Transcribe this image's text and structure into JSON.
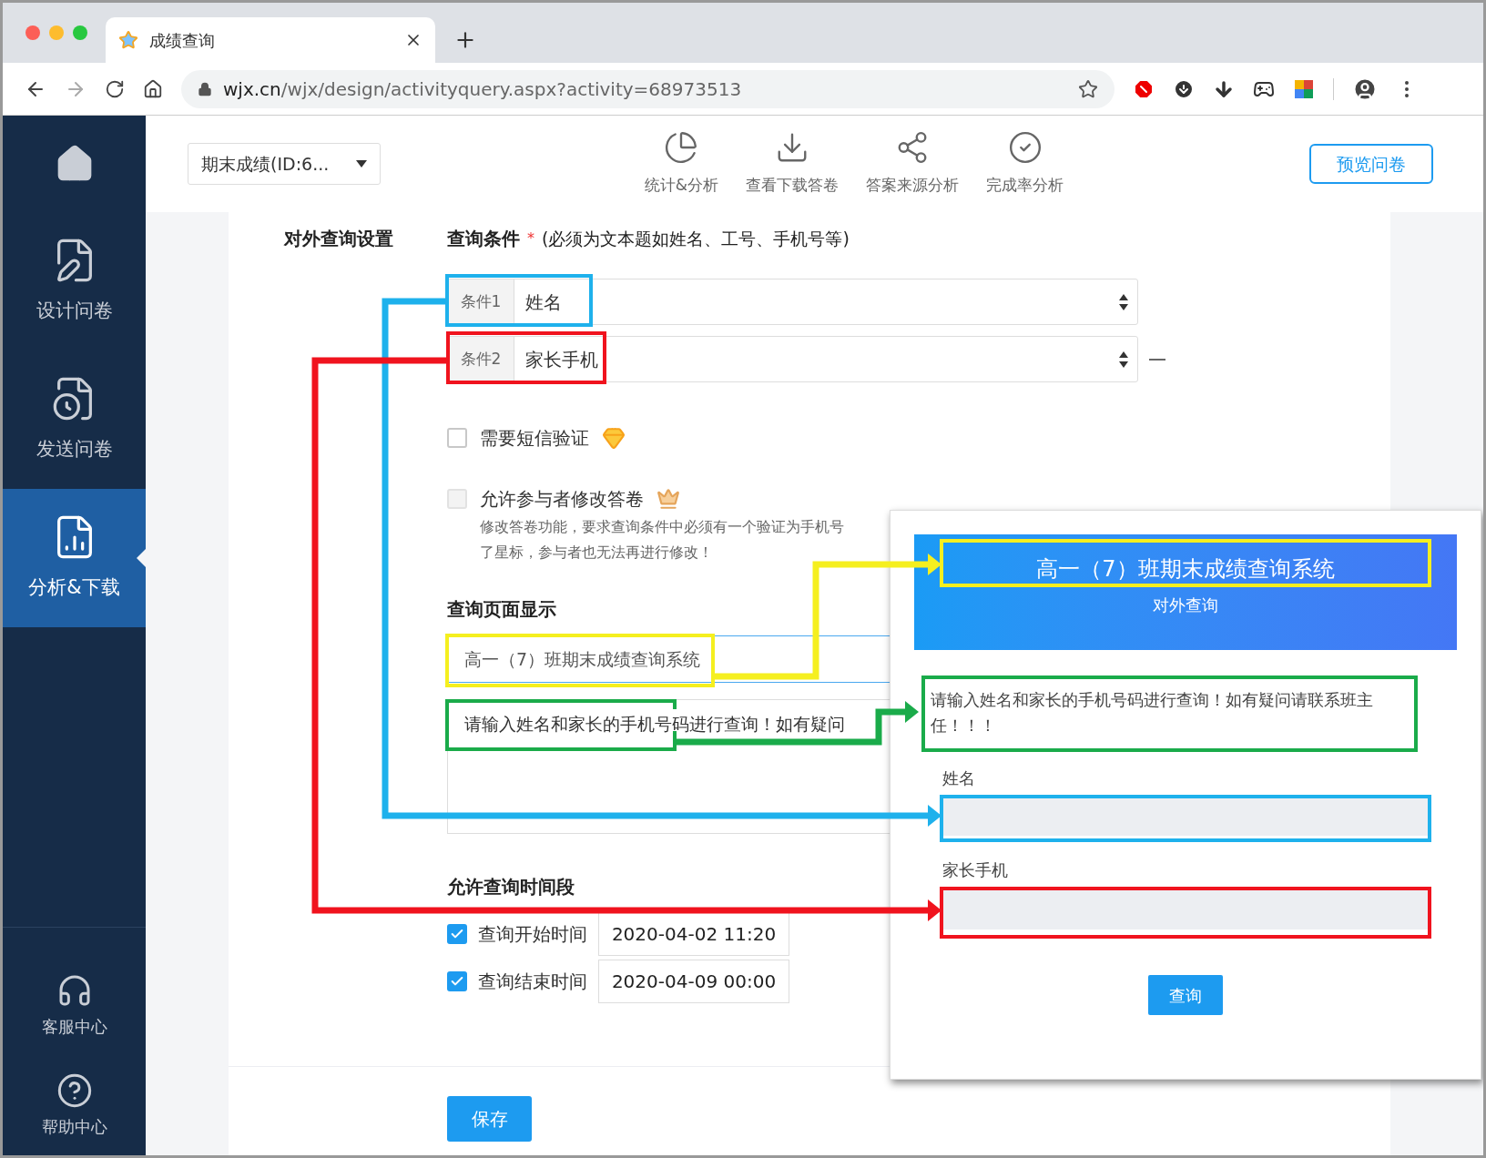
{
  "browser": {
    "tab_title": "成绩查询",
    "url_host": "wjx.cn",
    "url_path": "/wjx/design/activityquery.aspx?activity=68973513"
  },
  "sidebar": {
    "items": [
      {
        "label": "设计问卷",
        "selected": false
      },
      {
        "label": "发送问卷",
        "selected": false
      },
      {
        "label": "分析&下载",
        "selected": true
      }
    ],
    "footer_items": [
      {
        "label": "客服中心"
      },
      {
        "label": "帮助中心"
      }
    ]
  },
  "toolbar": {
    "survey_select": "期末成绩(ID:6...",
    "nav": [
      {
        "label": "统计&分析"
      },
      {
        "label": "查看下载答卷"
      },
      {
        "label": "答案来源分析"
      },
      {
        "label": "完成率分析"
      }
    ],
    "preview_button": "预览问卷"
  },
  "settings": {
    "section_label": "对外查询设置",
    "conditions_heading": "查询条件",
    "required_mark": "*",
    "conditions_hint": "(必须为文本题如姓名、工号、手机号等)",
    "conditions": [
      {
        "prefix": "条件1",
        "value": "姓名",
        "removable": false
      },
      {
        "prefix": "条件2",
        "value": "家长手机",
        "removable": true
      }
    ],
    "options": [
      {
        "label": "需要短信验证",
        "checked": false,
        "disabled": false
      },
      {
        "label": "允许参与者修改答卷",
        "checked": false,
        "disabled": true,
        "note_lines": [
          "修改答卷功能，要求查询条件中必须有一个验证为手机号",
          "了星标，参与者也无法再进行修改！"
        ]
      }
    ],
    "display_heading": "查询页面显示",
    "title_input": "高一（7）班期末成绩查询系统",
    "intro_textarea": "请输入姓名和家长的手机号码进行查询！如有疑问",
    "time_heading": "允许查询时间段",
    "time_ranges": [
      {
        "label": "查询开始时间",
        "checked": true,
        "value": "2020-04-02 11:20"
      },
      {
        "label": "查询结束时间",
        "checked": true,
        "value": "2020-04-09 00:00"
      }
    ],
    "save_button": "保存"
  },
  "preview": {
    "title": "高一（7）班期末成绩查询系统",
    "subtitle": "对外查询",
    "intro": "请输入姓名和家长的手机号码进行查询！如有疑问请联系班主任！！！",
    "fields": [
      {
        "label": "姓名"
      },
      {
        "label": "家长手机"
      }
    ],
    "submit": "查询"
  },
  "annotations": [
    {
      "color": "#1eb1ec"
    },
    {
      "color": "#f0131e"
    },
    {
      "color": "#f5ef1f"
    },
    {
      "color": "#1aab4a"
    }
  ]
}
